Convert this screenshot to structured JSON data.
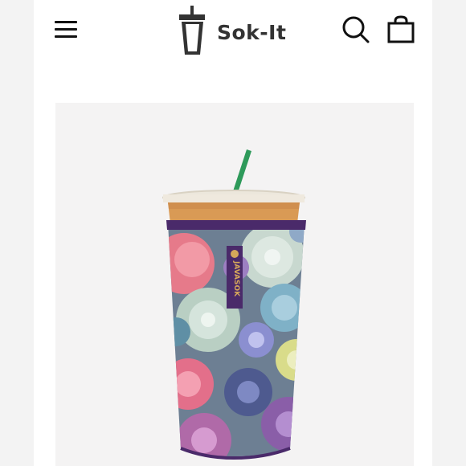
{
  "header": {
    "brand_name": "Sok-It",
    "menu_icon": "hamburger-menu-icon",
    "search_icon": "search-icon",
    "bag_icon": "shopping-bag-icon"
  },
  "product": {
    "sleeve_brand_text": "JAVASOK",
    "sleeve_colors": {
      "trim": "#4a2a6a",
      "straw": "#2e9a5a",
      "coffee": "#d99a55"
    }
  }
}
